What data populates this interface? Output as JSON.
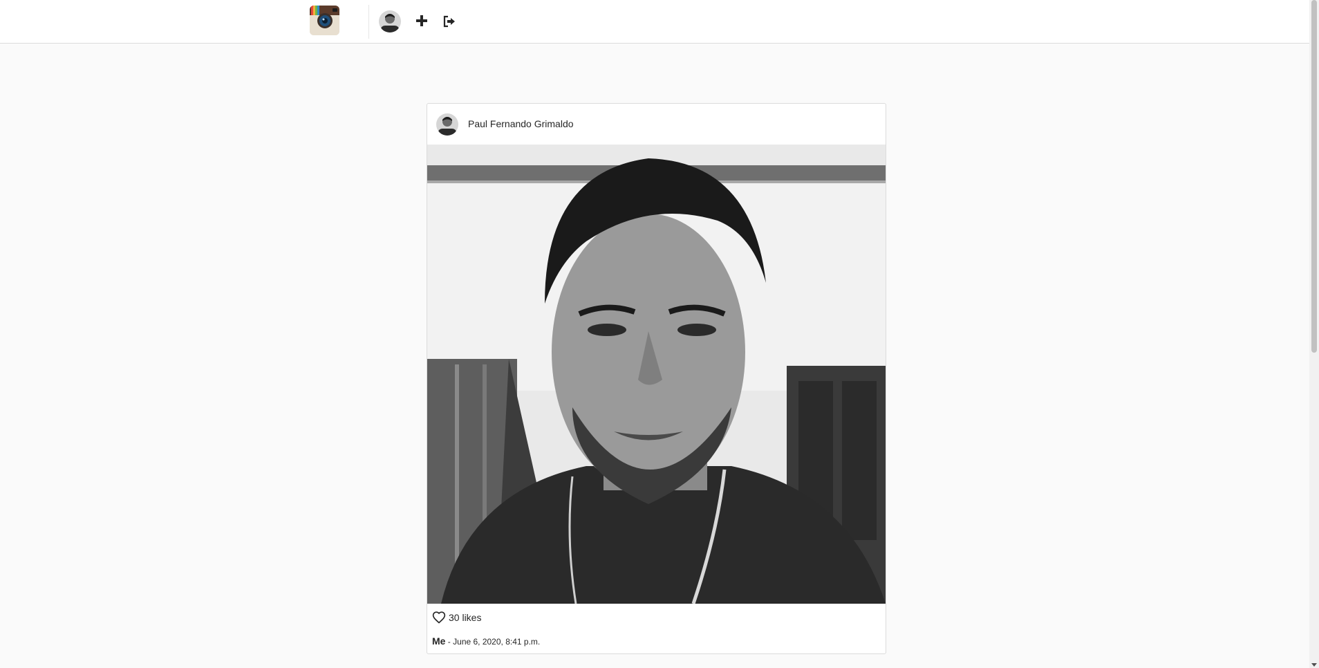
{
  "nav": {
    "logo_icon": "camera-logo-icon",
    "avatar_icon": "user-avatar-icon",
    "add_icon": "plus-icon",
    "logout_icon": "logout-icon"
  },
  "post": {
    "author": "Paul Fernando Grimaldo",
    "photo_icon": "portrait-photo",
    "like_icon": "heart-outline-icon",
    "likes": "30 likes",
    "caption": "Me",
    "separator": " - ",
    "date": "June 6, 2020, 8:41 p.m."
  },
  "colors": {
    "topbar_bg": "#ffffff",
    "page_bg": "#fafafa",
    "border": "#dbdbdb",
    "text": "#262626"
  }
}
